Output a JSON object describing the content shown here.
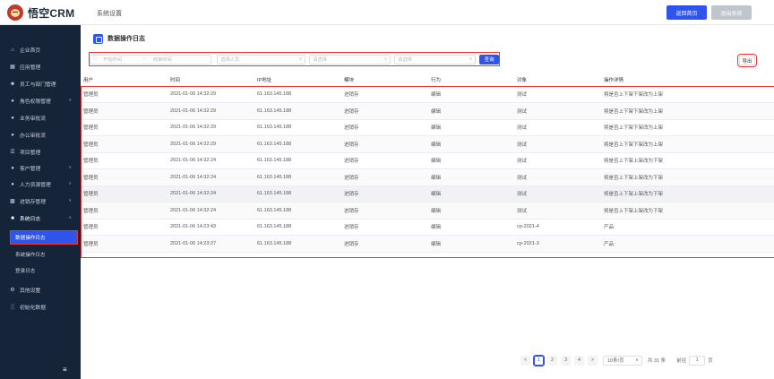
{
  "app": {
    "logo_text": "悟空CRM",
    "breadcrumb": "系统设置",
    "home_button": "返回首页",
    "logout_button": "退出系统"
  },
  "sidebar": {
    "items": [
      {
        "label": "企业首页",
        "icon": "home-icon"
      },
      {
        "label": "应用管理",
        "icon": "apps-icon"
      },
      {
        "label": "员工与部门管理",
        "icon": "users-icon"
      },
      {
        "label": "角色权限管理",
        "icon": "role-icon",
        "chevron": "down"
      },
      {
        "label": "业务审批流",
        "icon": "approval-icon"
      },
      {
        "label": "办公审批流",
        "icon": "office-approval-icon"
      },
      {
        "label": "项目管理",
        "icon": "project-icon"
      },
      {
        "label": "客户管理",
        "icon": "customer-icon",
        "chevron": "down"
      },
      {
        "label": "人力资源管理",
        "icon": "hr-icon",
        "chevron": "down"
      },
      {
        "label": "进销存管理",
        "icon": "inventory-icon",
        "chevron": "down"
      },
      {
        "label": "系统日志",
        "icon": "log-icon",
        "chevron": "up"
      }
    ],
    "sub_items": [
      "数据操作日志",
      "系统操作日志",
      "登录日志"
    ],
    "bottom_items": [
      {
        "label": "其他设置",
        "icon": "gear-icon"
      },
      {
        "label": "初始化数据",
        "icon": "chart-icon"
      }
    ],
    "collapse_icon": "≡"
  },
  "page": {
    "title": "数据操作日志"
  },
  "filters": {
    "start_placeholder": "开始时间",
    "end_placeholder": "结束时间",
    "date_separator": "-",
    "user_placeholder": "选择人员",
    "module_placeholder": "请选择",
    "action_placeholder": "请选择",
    "search_button": "查询",
    "export_button": "导出"
  },
  "table": {
    "columns": [
      "用户",
      "时间",
      "IP地址",
      "模块",
      "行为",
      "对象",
      "操作详情"
    ],
    "rows": [
      [
        "管理员",
        "2021-01-06 14:32:29",
        "61.163.145.188",
        "进销存",
        "编辑",
        "测试",
        "将是否上下架下架改为上架"
      ],
      [
        "管理员",
        "2021-01-06 14:32:29",
        "61.163.145.188",
        "进销存",
        "编辑",
        "测试",
        "将是否上下架下架改为上架"
      ],
      [
        "管理员",
        "2021-01-06 14:32:29",
        "61.163.145.188",
        "进销存",
        "编辑",
        "测试",
        "将是否上下架下架改为上架"
      ],
      [
        "管理员",
        "2021-01-06 14:32:29",
        "61.163.145.188",
        "进销存",
        "编辑",
        "测试",
        "将是否上下架下架改为上架"
      ],
      [
        "管理员",
        "2021-01-06 14:32:24",
        "61.163.145.188",
        "进销存",
        "编辑",
        "测试",
        "将是否上下架上架改为下架"
      ],
      [
        "管理员",
        "2021-01-06 14:32:24",
        "61.163.145.188",
        "进销存",
        "编辑",
        "测试",
        "将是否上下架上架改为下架"
      ],
      [
        "管理员",
        "2021-01-06 14:32:24",
        "61.163.145.188",
        "进销存",
        "编辑",
        "测试",
        "将是否上下架上架改为下架"
      ],
      [
        "管理员",
        "2021-01-06 14:32:24",
        "61.163.145.188",
        "进销存",
        "编辑",
        "测试",
        "将是否上下架上架改为下架"
      ],
      [
        "管理员",
        "2021-01-06 14:23:43",
        "61.163.145.188",
        "进销存",
        "编辑",
        "cp-2021-4",
        "产品:"
      ],
      [
        "管理员",
        "2021-01-06 14:23:27",
        "61.163.145.188",
        "进销存",
        "编辑",
        "cp-2021-3",
        "产品:"
      ]
    ]
  },
  "pagination": {
    "prev": "<",
    "next": ">",
    "pages": [
      "1",
      "2",
      "3",
      "4"
    ],
    "current": "1",
    "page_size": "10条/页",
    "total": "共 31 条",
    "goto_label": "前往",
    "goto_value": "1",
    "page_suffix": "页"
  }
}
